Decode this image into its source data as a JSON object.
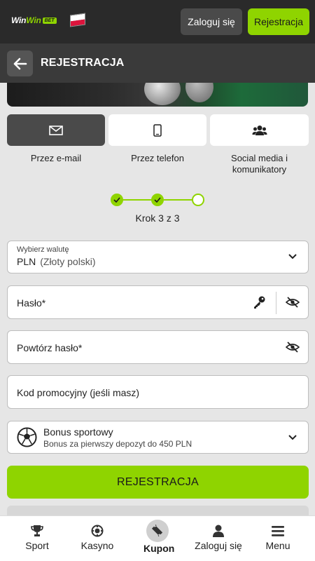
{
  "header": {
    "logo_text_1": "Win",
    "logo_text_2": "Win",
    "logo_badge": "BET",
    "login_label": "Zaloguj się",
    "register_label": "Rejestracja"
  },
  "subheader": {
    "title": "REJESTRACJA"
  },
  "tabs": [
    {
      "label": "Przez e-mail",
      "icon": "envelope-icon",
      "active": true
    },
    {
      "label": "Przez telefon",
      "icon": "phone-icon",
      "active": false
    },
    {
      "label": "Social media i komunikatory",
      "icon": "users-icon",
      "active": false
    }
  ],
  "steps": {
    "current": 3,
    "total": 3,
    "text": "Krok 3 z 3"
  },
  "form": {
    "currency": {
      "label": "Wybierz walutę",
      "value_code": "PLN",
      "value_name": "(Złoty polski)"
    },
    "password": {
      "placeholder": "Hasło*"
    },
    "password_repeat": {
      "placeholder": "Powtórz hasło*"
    },
    "promo": {
      "placeholder": "Kod promocyjny (jeśli masz)"
    },
    "bonus": {
      "title": "Bonus sportowy",
      "subtitle": "Bonus za pierwszy depozyt do 450 PLN"
    },
    "submit_label": "REJESTRACJA"
  },
  "bottom_nav": [
    {
      "label": "Sport",
      "icon": "trophy-icon"
    },
    {
      "label": "Kasyno",
      "icon": "casino-chip-icon"
    },
    {
      "label": "Kupon",
      "icon": "ticket-icon"
    },
    {
      "label": "Zaloguj się",
      "icon": "user-icon"
    },
    {
      "label": "Menu",
      "icon": "hamburger-icon"
    }
  ],
  "colors": {
    "accent": "#8fd400",
    "header_bg": "#2a2a2a",
    "subheader_bg": "#3a3a3a",
    "page_bg": "#e6e6e6"
  }
}
